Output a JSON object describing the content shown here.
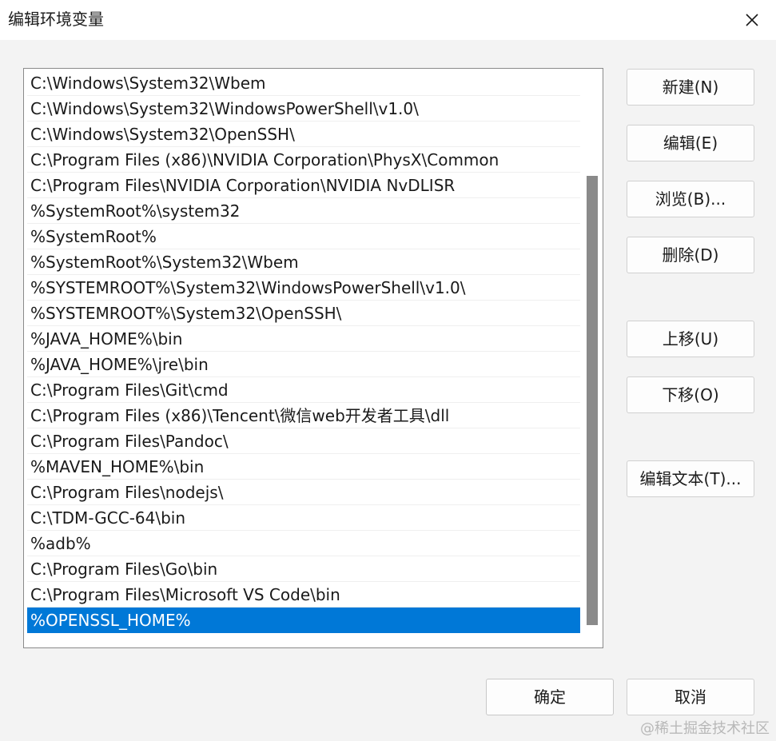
{
  "window": {
    "title": "编辑环境变量",
    "close_glyph": "✕"
  },
  "path_list": {
    "items": [
      "C:\\Windows\\System32\\Wbem",
      "C:\\Windows\\System32\\WindowsPowerShell\\v1.0\\",
      "C:\\Windows\\System32\\OpenSSH\\",
      "C:\\Program Files (x86)\\NVIDIA Corporation\\PhysX\\Common",
      "C:\\Program Files\\NVIDIA Corporation\\NVIDIA NvDLISR",
      "%SystemRoot%\\system32",
      "%SystemRoot%",
      "%SystemRoot%\\System32\\Wbem",
      "%SYSTEMROOT%\\System32\\WindowsPowerShell\\v1.0\\",
      "%SYSTEMROOT%\\System32\\OpenSSH\\",
      "%JAVA_HOME%\\bin",
      "%JAVA_HOME%\\jre\\bin",
      "C:\\Program Files\\Git\\cmd",
      "C:\\Program Files (x86)\\Tencent\\微信web开发者工具\\dll",
      "C:\\Program Files\\Pandoc\\",
      "%MAVEN_HOME%\\bin",
      "C:\\Program Files\\nodejs\\",
      "C:\\TDM-GCC-64\\bin",
      "%adb%",
      "C:\\Program Files\\Go\\bin",
      "C:\\Program Files\\Microsoft VS Code\\bin",
      "%OPENSSL_HOME%"
    ],
    "selected_index": 21
  },
  "buttons": {
    "new": "新建(N)",
    "edit": "编辑(E)",
    "browse": "浏览(B)...",
    "delete": "删除(D)",
    "move_up": "上移(U)",
    "move_down": "下移(O)",
    "edit_text": "编辑文本(T)...",
    "ok": "确定",
    "cancel": "取消"
  },
  "watermark": "@稀土掘金技术社区",
  "colors": {
    "selection": "#0078d7",
    "scrollbar_thumb": "#8a8a8a"
  }
}
